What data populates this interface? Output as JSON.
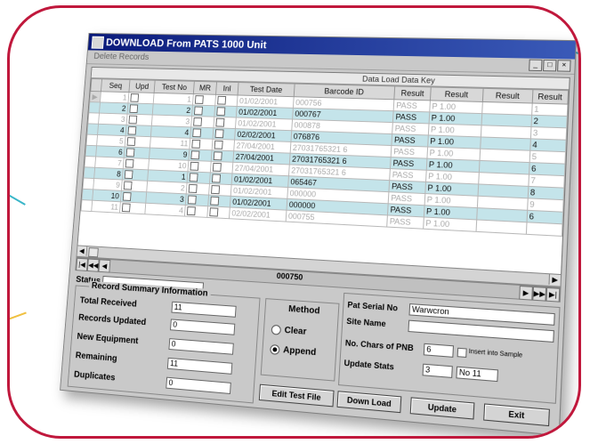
{
  "window": {
    "title": "DOWNLOAD From PATS 1000 Unit",
    "menu_item": "Delete Records",
    "controls": [
      "_",
      "□",
      "×"
    ]
  },
  "grid": {
    "group_title": "Data Load Data Key",
    "columns": [
      "Seq",
      "Upd",
      "Test No",
      "MR",
      "Inl",
      "Test Date",
      "Barcode ID",
      "Result",
      "Result",
      "Result",
      "Result"
    ],
    "rows": [
      {
        "seq": "1",
        "test_no": "1",
        "date": "01/02/2001",
        "barcode": "000756",
        "r1": "PASS",
        "r2": "P 1.00",
        "r4": "1"
      },
      {
        "seq": "2",
        "test_no": "2",
        "date": "01/02/2001",
        "barcode": "000767",
        "r1": "PASS",
        "r2": "P 1.00",
        "r4": "2"
      },
      {
        "seq": "3",
        "test_no": "3",
        "date": "01/02/2001",
        "barcode": "000878",
        "r1": "PASS",
        "r2": "P 1.00",
        "r4": "3"
      },
      {
        "seq": "4",
        "test_no": "4",
        "date": "02/02/2001",
        "barcode": "076876",
        "r1": "PASS",
        "r2": "P 1.00",
        "r4": "4"
      },
      {
        "seq": "5",
        "test_no": "11",
        "date": "27/04/2001",
        "barcode": "27031765321 6",
        "r1": "PASS",
        "r2": "P 1.00",
        "r4": "5"
      },
      {
        "seq": "6",
        "test_no": "9",
        "date": "27/04/2001",
        "barcode": "27031765321 6",
        "r1": "PASS",
        "r2": "P 1.00",
        "r4": "6"
      },
      {
        "seq": "7",
        "test_no": "10",
        "date": "27/04/2001",
        "barcode": "27031765321 6",
        "r1": "PASS",
        "r2": "P 1.00",
        "r4": "7"
      },
      {
        "seq": "8",
        "test_no": "1",
        "date": "01/02/2001",
        "barcode": "065467",
        "r1": "PASS",
        "r2": "P 1.00",
        "r4": "8"
      },
      {
        "seq": "9",
        "test_no": "2",
        "date": "01/02/2001",
        "barcode": "000000",
        "r1": "PASS",
        "r2": "P 1.00",
        "r4": "9"
      },
      {
        "seq": "10",
        "test_no": "3",
        "date": "01/02/2001",
        "barcode": "000000",
        "r1": "PASS",
        "r2": "P 1.00",
        "r4": "6"
      },
      {
        "seq": "11",
        "test_no": "4",
        "date": "02/02/2001",
        "barcode": "000755",
        "r1": "PASS",
        "r2": "P 1.00",
        "r4": ""
      }
    ]
  },
  "navigator": {
    "record_count": "000750"
  },
  "status": {
    "label": "Status"
  },
  "summary": {
    "legend": "Record Summary Information",
    "total_received_label": "Total Received",
    "total_received": "11",
    "records_updated_label": "Records Updated",
    "records_updated": "0",
    "new_equipment_label": "New Equipment",
    "new_equipment": "0",
    "remaining_label": "Remaining",
    "remaining": "11",
    "duplicates_label": "Duplicates",
    "duplicates": "0"
  },
  "method": {
    "legend": "Method",
    "clear": "Clear",
    "append": "Append"
  },
  "right": {
    "pat_serial_label": "Pat Serial No",
    "pat_serial": "Warwcron",
    "site_name_label": "Site Name",
    "site_name": "",
    "no_chars_label": "No. Chars of PNB",
    "no_chars": "6",
    "insert_label": "Insert into Sample",
    "update_stats_label": "Update Stats",
    "update_stats": "3",
    "update_stats2": "No 11"
  },
  "buttons": {
    "edit_test_file": "Edit Test File",
    "down_load": "Down Load",
    "update": "Update",
    "exit": "Exit"
  }
}
